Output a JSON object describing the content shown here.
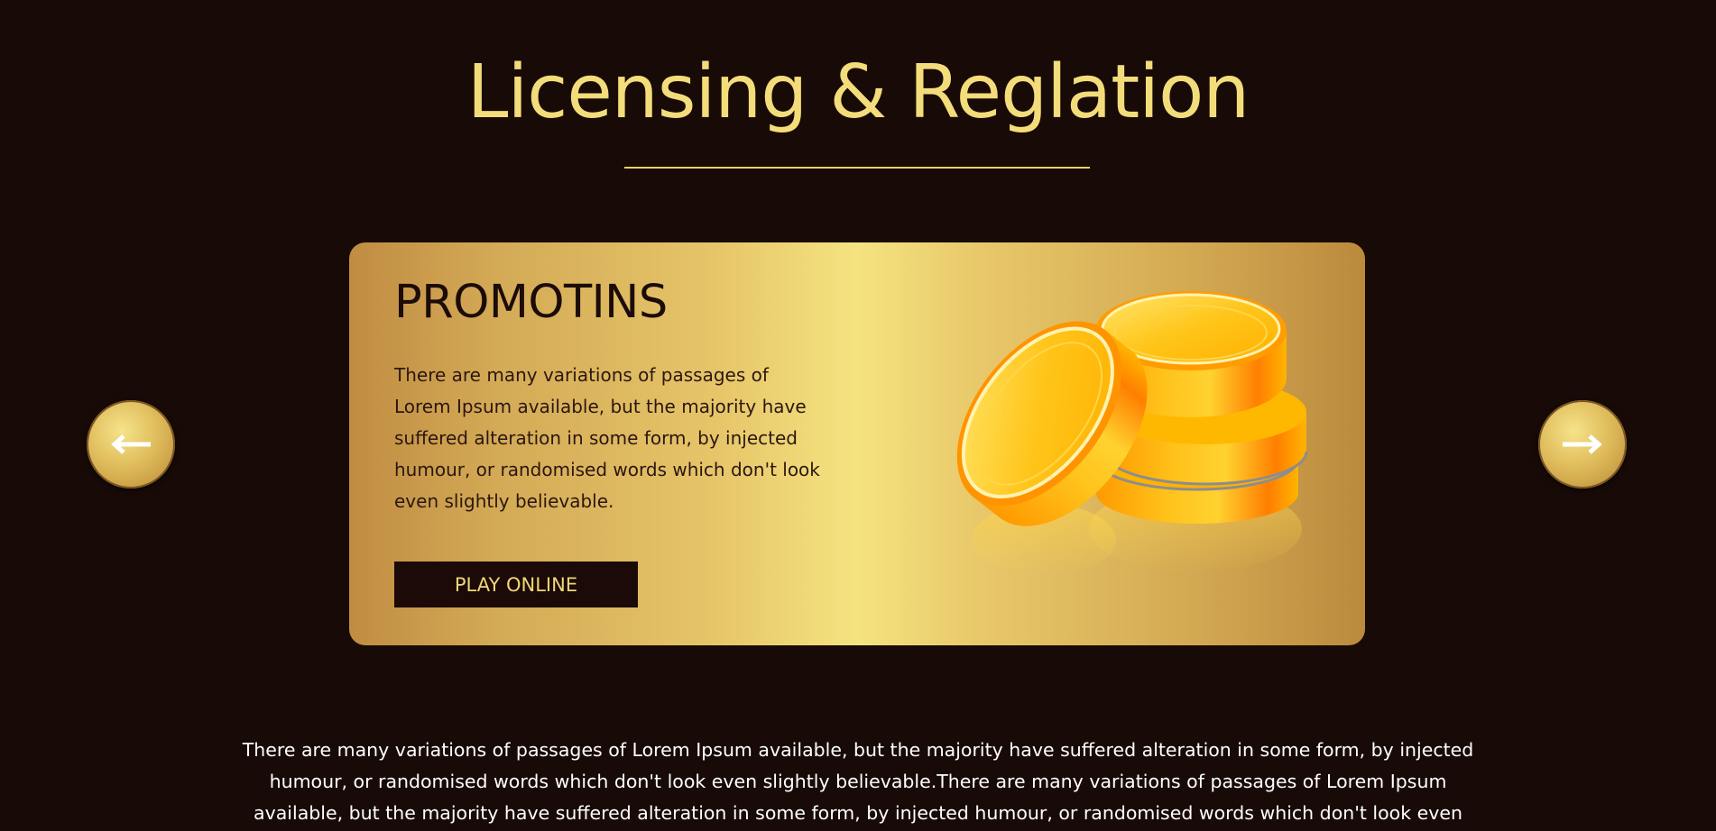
{
  "section": {
    "title": "Licensing & Reglation"
  },
  "promo": {
    "heading": "PROMOTINS",
    "text": "There are many variations of passages of Lorem Ipsum available, but the majority have suffered alteration in some form, by injected humour, or randomised words which don't look even slightly believable.",
    "button_label": "PLAY ONLINE",
    "image": "gold-coins"
  },
  "carousel": {
    "prev_icon": "arrow-left-icon",
    "next_icon": "arrow-right-icon"
  },
  "footer": {
    "text": "There are many variations of passages of Lorem Ipsum available, but the majority have suffered alteration in some form, by injected humour, or randomised words which don't look even slightly believable.There are many variations of passages of Lorem Ipsum available, but the majority have suffered alteration in some form, by injected humour, or randomised words which don't look even slightly believable."
  },
  "colors": {
    "background": "#180a07",
    "accent_gold": "#f3dc7a",
    "card_dark_text": "#1b0c08"
  }
}
